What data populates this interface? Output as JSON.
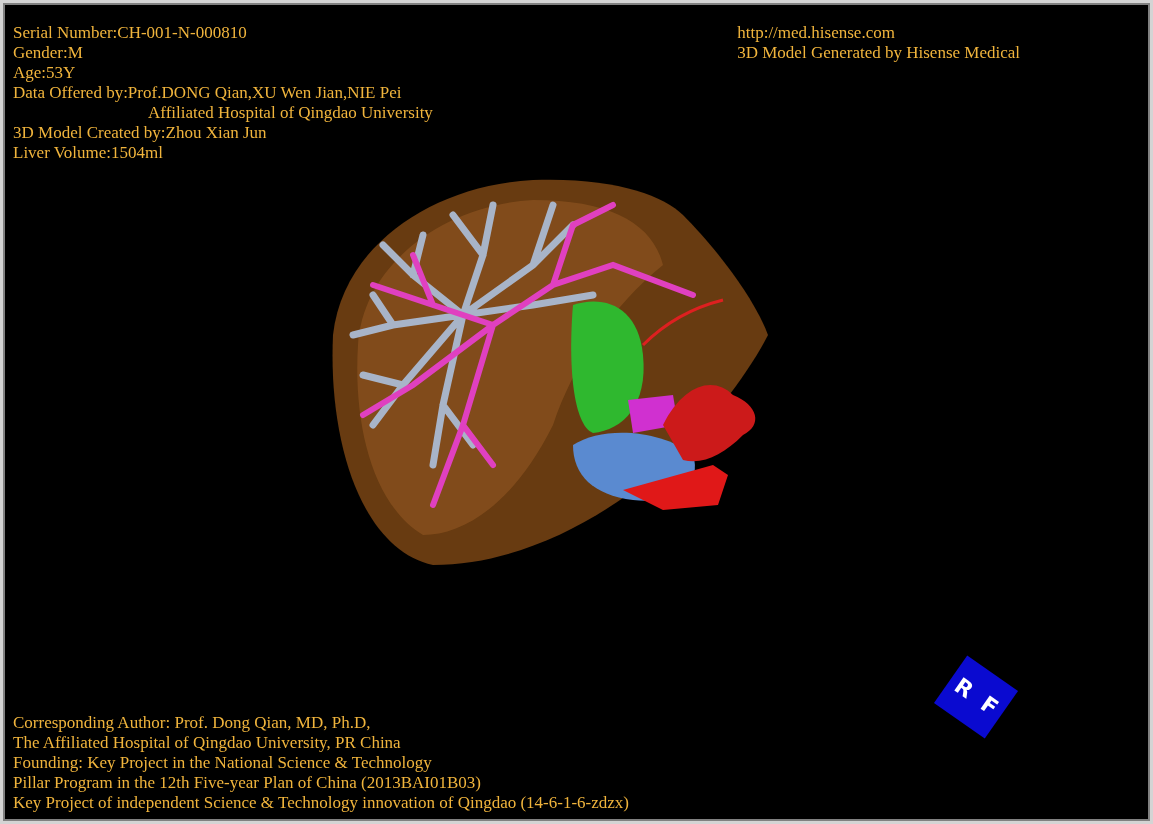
{
  "patient_info": [
    {
      "text": "Serial Number:CH-001-N-000810",
      "indented": false
    },
    {
      "text": "Gender:M",
      "indented": false
    },
    {
      "text": "Age:53Y",
      "indented": false
    },
    {
      "text": "Data Offered by:Prof.DONG Qian,XU Wen Jian,NIE Pei",
      "indented": false
    },
    {
      "text": "Affiliated Hospital of Qingdao University",
      "indented": true
    },
    {
      "text": "3D Model Created by:Zhou Xian Jun",
      "indented": false
    },
    {
      "text": "Liver Volume:1504ml",
      "indented": false
    }
  ],
  "header_right": {
    "link": "http://med.hisense.com",
    "caption": "3D Model Generated by Hisense Medical"
  },
  "orientation_cube": {
    "labels": [
      "R",
      "F"
    ]
  },
  "credits": [
    "Corresponding Author: Prof. Dong Qian, MD, Ph.D,",
    "The Affiliated Hospital of Qingdao University, PR China",
    "Founding: Key Project in the National Science & Technology",
    "Pillar Program in the 12th Five-year Plan of China (2013BAI01B03)",
    "Key Project of independent Science & Technology innovation of Qingdao (14-6-1-6-zdzx)"
  ]
}
